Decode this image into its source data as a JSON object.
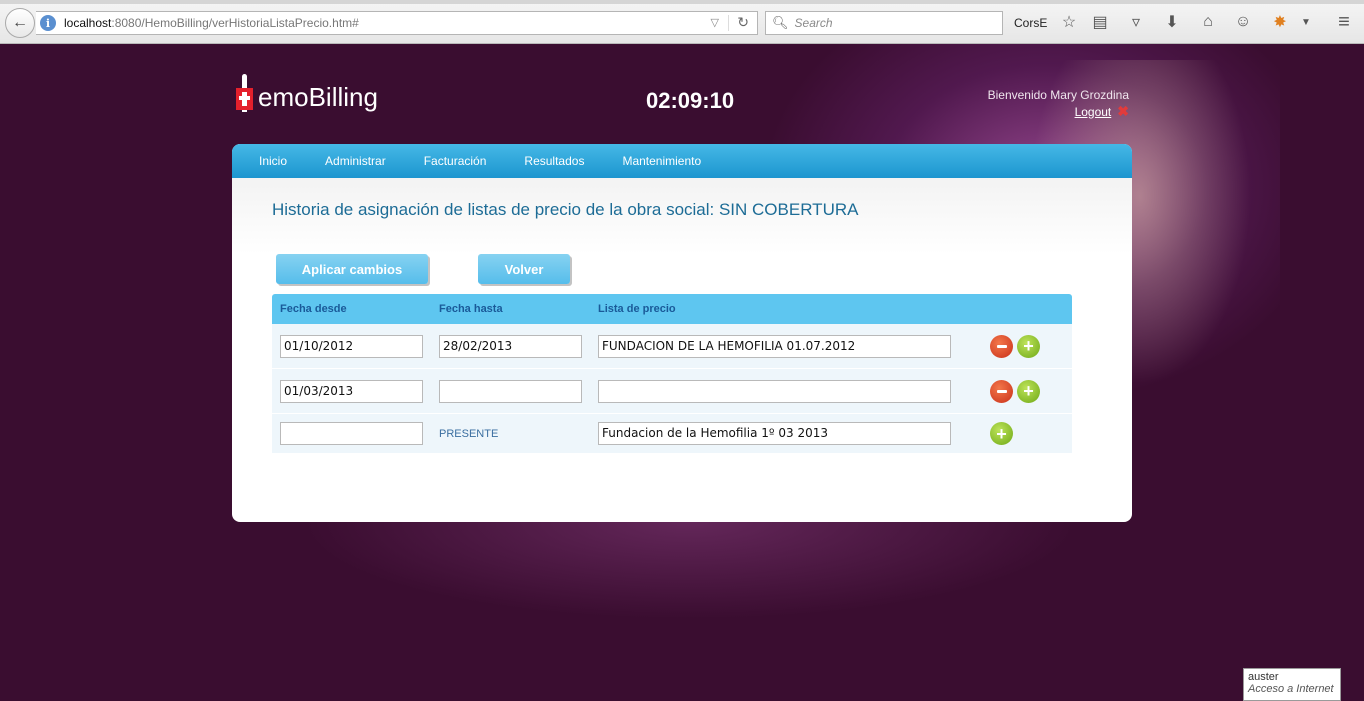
{
  "browser": {
    "url_host": "localhost",
    "url_rest": ":8080/HemoBilling/verHistoriaListaPrecio.htm#",
    "search_placeholder": "Search",
    "toolbar_label": "CorsE",
    "icons": [
      "back-icon",
      "info-icon",
      "reload-icon",
      "search-icon",
      "star-icon",
      "reading-list-icon",
      "pocket-icon",
      "download-icon",
      "home-icon",
      "chat-icon",
      "extension-icon",
      "menu-icon"
    ]
  },
  "header": {
    "logo_text": "emoBilling",
    "clock": "02:09:10",
    "welcome": "Bienvenido Mary Grozdina",
    "logout": "Logout"
  },
  "nav": {
    "items": [
      "Inicio",
      "Administrar",
      "Facturación",
      "Resultados",
      "Mantenimiento"
    ]
  },
  "page": {
    "title": "Historia de asignación de listas de precio de la obra social: SIN COBERTURA",
    "btn_apply": "Aplicar cambios",
    "btn_back": "Volver"
  },
  "grid": {
    "headers": [
      "Fecha desde",
      "Fecha hasta",
      "Lista de precio"
    ],
    "rows": [
      {
        "desde": "01/10/2012",
        "hasta": "28/02/2013",
        "lista": "FUNDACION DE LA HEMOFILIA 01.07.2012",
        "actions": [
          "remove",
          "add"
        ]
      },
      {
        "desde": "01/03/2013",
        "hasta": "",
        "lista": "",
        "actions": [
          "remove",
          "add"
        ]
      },
      {
        "desde": "",
        "hasta": "PRESENTE",
        "lista": "Fundacion de la Hemofilia 1º  03 2013",
        "actions": [
          "add"
        ]
      }
    ]
  },
  "tooltip": {
    "line1": "auster",
    "line2": "Acceso a Internet"
  },
  "colors": {
    "background": "#3a0d30",
    "nav": "#1c95cf",
    "title": "#1d6c96",
    "button": "#56bdeb"
  }
}
